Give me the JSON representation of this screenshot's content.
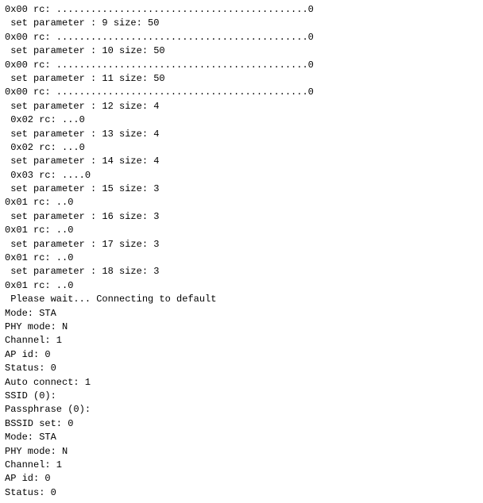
{
  "console": {
    "lines": [
      "0x00 rc: ............................................0",
      " set parameter : 9 size: 50",
      "0x00 rc: ............................................0",
      " set parameter : 10 size: 50",
      "0x00 rc: ............................................0",
      " set parameter : 11 size: 50",
      "0x00 rc: ............................................0",
      " set parameter : 12 size: 4",
      " 0x02 rc: ...0",
      " set parameter : 13 size: 4",
      " 0x02 rc: ...0",
      " set parameter : 14 size: 4",
      " 0x03 rc: ....0",
      " set parameter : 15 size: 3",
      "0x01 rc: ..0",
      " set parameter : 16 size: 3",
      "0x01 rc: ..0",
      " set parameter : 17 size: 3",
      "0x01 rc: ..0",
      " set parameter : 18 size: 3",
      "0x01 rc: ..0",
      "",
      " Please wait... Connecting to default",
      "Mode: STA",
      "PHY mode: N",
      "Channel: 1",
      "AP id: 0",
      "Status: 0",
      "Auto connect: 1",
      "SSID (0):",
      "Passphrase (0):",
      "BSSID set: 0",
      "Mode: STA",
      "PHY mode: N",
      "Channel: 1",
      "AP id: 0",
      "Status: 0"
    ]
  }
}
